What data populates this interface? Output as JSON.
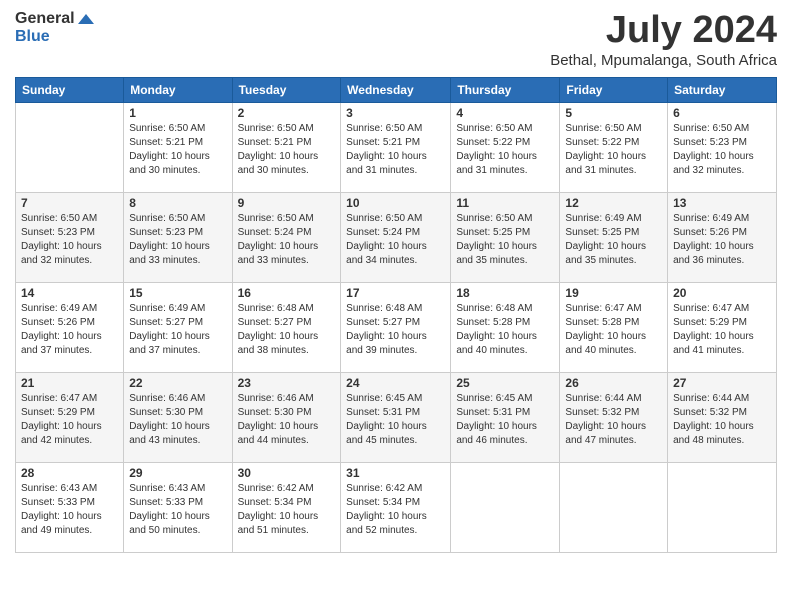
{
  "header": {
    "logo_general": "General",
    "logo_blue": "Blue",
    "title": "July 2024",
    "location": "Bethal, Mpumalanga, South Africa"
  },
  "days_of_week": [
    "Sunday",
    "Monday",
    "Tuesday",
    "Wednesday",
    "Thursday",
    "Friday",
    "Saturday"
  ],
  "weeks": [
    [
      {
        "day": "",
        "info": ""
      },
      {
        "day": "1",
        "info": "Sunrise: 6:50 AM\nSunset: 5:21 PM\nDaylight: 10 hours and 30 minutes."
      },
      {
        "day": "2",
        "info": "Sunrise: 6:50 AM\nSunset: 5:21 PM\nDaylight: 10 hours and 30 minutes."
      },
      {
        "day": "3",
        "info": "Sunrise: 6:50 AM\nSunset: 5:21 PM\nDaylight: 10 hours and 31 minutes."
      },
      {
        "day": "4",
        "info": "Sunrise: 6:50 AM\nSunset: 5:22 PM\nDaylight: 10 hours and 31 minutes."
      },
      {
        "day": "5",
        "info": "Sunrise: 6:50 AM\nSunset: 5:22 PM\nDaylight: 10 hours and 31 minutes."
      },
      {
        "day": "6",
        "info": "Sunrise: 6:50 AM\nSunset: 5:23 PM\nDaylight: 10 hours and 32 minutes."
      }
    ],
    [
      {
        "day": "7",
        "info": "Sunrise: 6:50 AM\nSunset: 5:23 PM\nDaylight: 10 hours and 32 minutes."
      },
      {
        "day": "8",
        "info": "Sunrise: 6:50 AM\nSunset: 5:23 PM\nDaylight: 10 hours and 33 minutes."
      },
      {
        "day": "9",
        "info": "Sunrise: 6:50 AM\nSunset: 5:24 PM\nDaylight: 10 hours and 33 minutes."
      },
      {
        "day": "10",
        "info": "Sunrise: 6:50 AM\nSunset: 5:24 PM\nDaylight: 10 hours and 34 minutes."
      },
      {
        "day": "11",
        "info": "Sunrise: 6:50 AM\nSunset: 5:25 PM\nDaylight: 10 hours and 35 minutes."
      },
      {
        "day": "12",
        "info": "Sunrise: 6:49 AM\nSunset: 5:25 PM\nDaylight: 10 hours and 35 minutes."
      },
      {
        "day": "13",
        "info": "Sunrise: 6:49 AM\nSunset: 5:26 PM\nDaylight: 10 hours and 36 minutes."
      }
    ],
    [
      {
        "day": "14",
        "info": "Sunrise: 6:49 AM\nSunset: 5:26 PM\nDaylight: 10 hours and 37 minutes."
      },
      {
        "day": "15",
        "info": "Sunrise: 6:49 AM\nSunset: 5:27 PM\nDaylight: 10 hours and 37 minutes."
      },
      {
        "day": "16",
        "info": "Sunrise: 6:48 AM\nSunset: 5:27 PM\nDaylight: 10 hours and 38 minutes."
      },
      {
        "day": "17",
        "info": "Sunrise: 6:48 AM\nSunset: 5:27 PM\nDaylight: 10 hours and 39 minutes."
      },
      {
        "day": "18",
        "info": "Sunrise: 6:48 AM\nSunset: 5:28 PM\nDaylight: 10 hours and 40 minutes."
      },
      {
        "day": "19",
        "info": "Sunrise: 6:47 AM\nSunset: 5:28 PM\nDaylight: 10 hours and 40 minutes."
      },
      {
        "day": "20",
        "info": "Sunrise: 6:47 AM\nSunset: 5:29 PM\nDaylight: 10 hours and 41 minutes."
      }
    ],
    [
      {
        "day": "21",
        "info": "Sunrise: 6:47 AM\nSunset: 5:29 PM\nDaylight: 10 hours and 42 minutes."
      },
      {
        "day": "22",
        "info": "Sunrise: 6:46 AM\nSunset: 5:30 PM\nDaylight: 10 hours and 43 minutes."
      },
      {
        "day": "23",
        "info": "Sunrise: 6:46 AM\nSunset: 5:30 PM\nDaylight: 10 hours and 44 minutes."
      },
      {
        "day": "24",
        "info": "Sunrise: 6:45 AM\nSunset: 5:31 PM\nDaylight: 10 hours and 45 minutes."
      },
      {
        "day": "25",
        "info": "Sunrise: 6:45 AM\nSunset: 5:31 PM\nDaylight: 10 hours and 46 minutes."
      },
      {
        "day": "26",
        "info": "Sunrise: 6:44 AM\nSunset: 5:32 PM\nDaylight: 10 hours and 47 minutes."
      },
      {
        "day": "27",
        "info": "Sunrise: 6:44 AM\nSunset: 5:32 PM\nDaylight: 10 hours and 48 minutes."
      }
    ],
    [
      {
        "day": "28",
        "info": "Sunrise: 6:43 AM\nSunset: 5:33 PM\nDaylight: 10 hours and 49 minutes."
      },
      {
        "day": "29",
        "info": "Sunrise: 6:43 AM\nSunset: 5:33 PM\nDaylight: 10 hours and 50 minutes."
      },
      {
        "day": "30",
        "info": "Sunrise: 6:42 AM\nSunset: 5:34 PM\nDaylight: 10 hours and 51 minutes."
      },
      {
        "day": "31",
        "info": "Sunrise: 6:42 AM\nSunset: 5:34 PM\nDaylight: 10 hours and 52 minutes."
      },
      {
        "day": "",
        "info": ""
      },
      {
        "day": "",
        "info": ""
      },
      {
        "day": "",
        "info": ""
      }
    ]
  ]
}
